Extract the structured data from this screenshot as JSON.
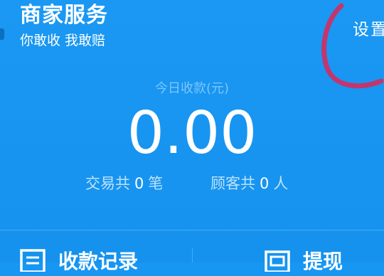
{
  "header": {
    "title": "商家服务",
    "subtitle": "你敢收 我敢赔",
    "settings_label": "设置"
  },
  "summary": {
    "today_label": "今日收款(元)",
    "amount": "0.00",
    "transactions": {
      "prefix": "交易共",
      "count": "0",
      "suffix": "笔"
    },
    "customers": {
      "prefix": "顾客共",
      "count": "0",
      "suffix": "人"
    }
  },
  "actions": {
    "records_label": "收款记录",
    "withdraw_label": "提现"
  },
  "colors": {
    "background": "#1796f2",
    "muted_text": "#7ec6fa",
    "annotation": "#c2366f"
  }
}
